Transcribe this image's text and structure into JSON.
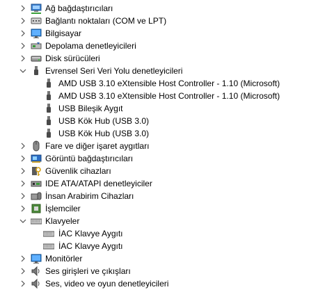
{
  "tree": {
    "nodes": [
      {
        "label": "Ağ bağdaştırıcıları",
        "icon": "network-adapter-icon",
        "expanded": false
      },
      {
        "label": "Bağlantı noktaları (COM ve LPT)",
        "icon": "port-icon",
        "expanded": false
      },
      {
        "label": "Bilgisayar",
        "icon": "computer-icon",
        "expanded": false
      },
      {
        "label": "Depolama denetleyicileri",
        "icon": "storage-controller-icon",
        "expanded": false
      },
      {
        "label": "Disk sürücüleri",
        "icon": "disk-drive-icon",
        "expanded": false
      },
      {
        "label": "Evrensel Seri Veri Yolu denetleyicileri",
        "icon": "usb-icon",
        "expanded": true,
        "children": [
          {
            "label": "AMD USB 3.10 eXtensible Host Controller - 1.10 (Microsoft)",
            "icon": "usb-device-icon"
          },
          {
            "label": "AMD USB 3.10 eXtensible Host Controller - 1.10 (Microsoft)",
            "icon": "usb-device-icon"
          },
          {
            "label": "USB Bileşik Aygıt",
            "icon": "usb-device-icon"
          },
          {
            "label": "USB Kök Hub (USB 3.0)",
            "icon": "usb-device-icon"
          },
          {
            "label": "USB Kök Hub (USB 3.0)",
            "icon": "usb-device-icon"
          }
        ]
      },
      {
        "label": "Fare ve diğer işaret aygıtları",
        "icon": "mouse-icon",
        "expanded": false
      },
      {
        "label": "Görüntü bağdaştırıcıları",
        "icon": "display-adapter-icon",
        "expanded": false
      },
      {
        "label": "Güvenlik cihazları",
        "icon": "security-device-icon",
        "expanded": false
      },
      {
        "label": "IDE ATA/ATAPI denetleyiciler",
        "icon": "ide-controller-icon",
        "expanded": false
      },
      {
        "label": "İnsan Arabirim Cihazları",
        "icon": "hid-icon",
        "expanded": false
      },
      {
        "label": "İşlemciler",
        "icon": "processor-icon",
        "expanded": false
      },
      {
        "label": "Klavyeler",
        "icon": "keyboard-icon",
        "expanded": true,
        "children": [
          {
            "label": "İAC Klavye Aygıtı",
            "icon": "keyboard-icon"
          },
          {
            "label": "İAC Klavye Aygıtı",
            "icon": "keyboard-icon"
          }
        ]
      },
      {
        "label": "Monitörler",
        "icon": "monitor-icon",
        "expanded": false
      },
      {
        "label": "Ses girişleri ve çıkışları",
        "icon": "speaker-icon",
        "expanded": false
      },
      {
        "label": "Ses, video ve oyun denetleyicileri",
        "icon": "sound-icon",
        "expanded": false
      }
    ]
  }
}
